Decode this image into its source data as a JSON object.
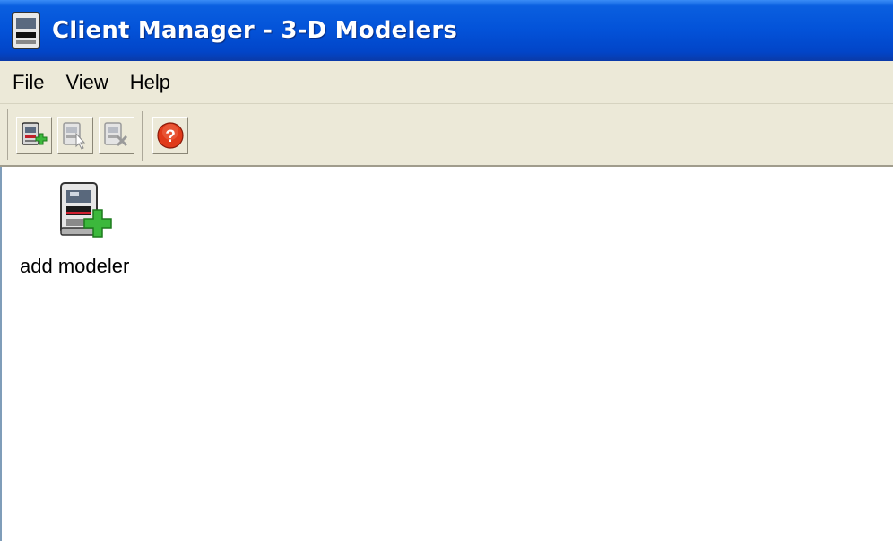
{
  "window": {
    "title": "Client Manager - 3-D Modelers",
    "icon": "modeler-app-icon"
  },
  "menubar": {
    "items": [
      {
        "label": "File"
      },
      {
        "label": "View"
      },
      {
        "label": "Help"
      }
    ]
  },
  "toolbar": {
    "buttons": [
      {
        "icon": "add-modeler-icon",
        "enabled": true
      },
      {
        "icon": "select-modeler-icon",
        "enabled": false
      },
      {
        "icon": "remove-modeler-icon",
        "enabled": false
      },
      {
        "icon": "help-icon",
        "enabled": true
      }
    ]
  },
  "content": {
    "items": [
      {
        "label": "add modeler",
        "icon": "add-modeler-icon"
      }
    ]
  },
  "colors": {
    "titlebar": "#0352d8",
    "chrome": "#ece9d8",
    "add_green": "#3cb83c",
    "help_red": "#d83a1a"
  }
}
